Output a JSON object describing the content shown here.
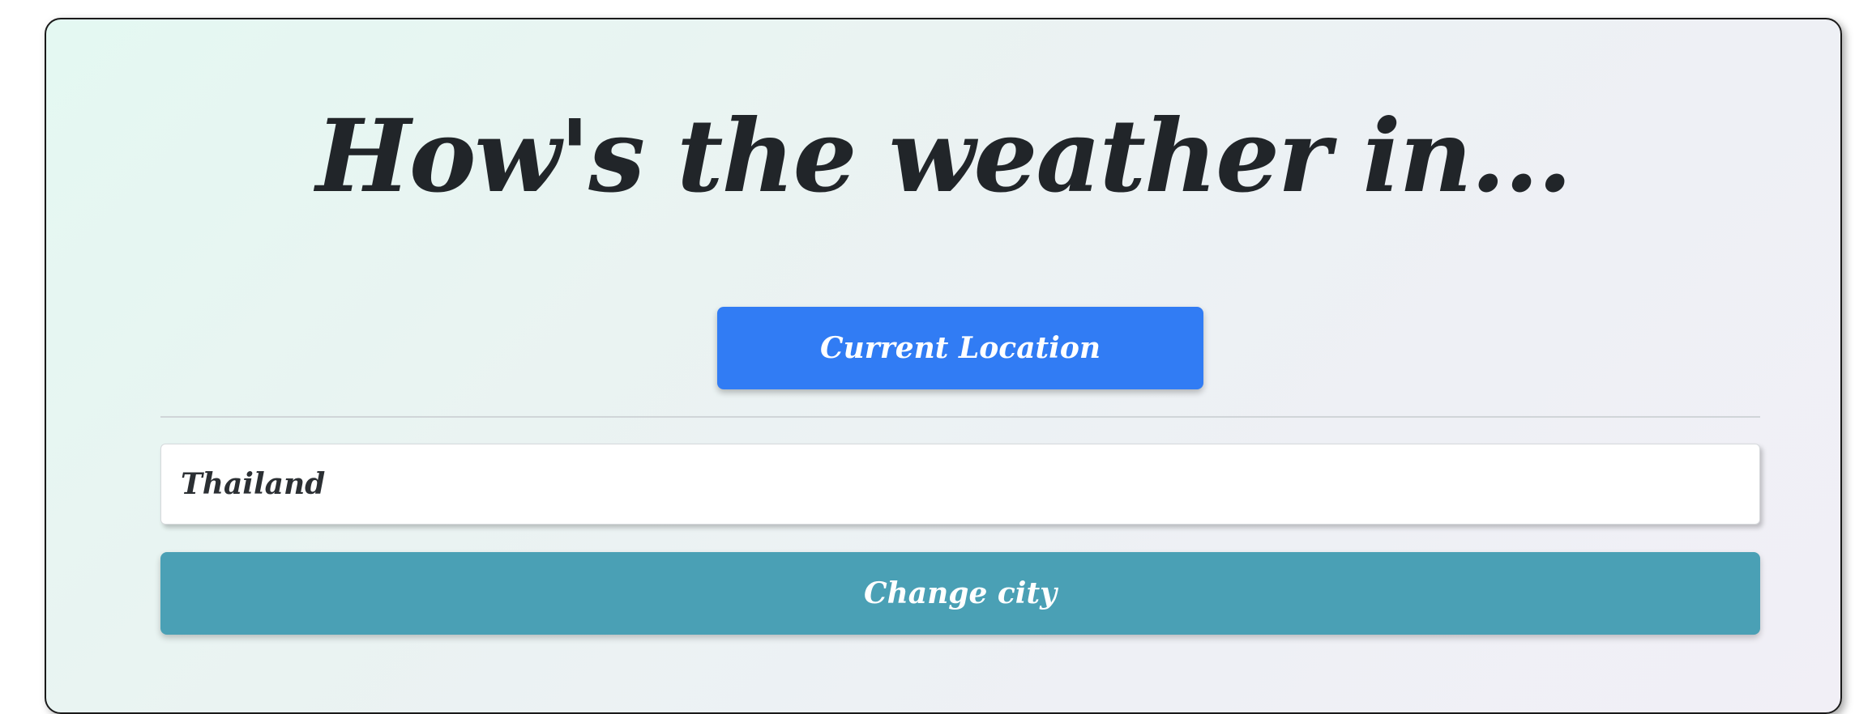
{
  "header": {
    "title": "How's the weather in..."
  },
  "location": {
    "button_label": "Current Location"
  },
  "city_form": {
    "input_value": "Thailand",
    "submit_label": "Change city"
  },
  "colors": {
    "primary_button": "#317cf4",
    "change_button": "#4aa0b5",
    "title_text": "#212529"
  }
}
